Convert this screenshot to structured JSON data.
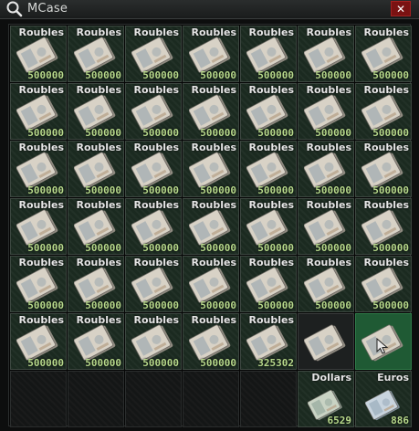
{
  "window": {
    "title": "MCase",
    "close_label": "✕"
  },
  "icons": {
    "title": "search-icon",
    "close": "close-icon",
    "cursor": "cursor-icon"
  },
  "colors": {
    "cell_filled": "#1b2a20",
    "selected": "#1f5a34",
    "close": "#7a1212",
    "count": "#b7d98b"
  },
  "grid": {
    "rows": [
      [
        {
          "name": "Roubles",
          "count": "500000"
        },
        {
          "name": "Roubles",
          "count": "500000"
        },
        {
          "name": "Roubles",
          "count": "500000"
        },
        {
          "name": "Roubles",
          "count": "500000"
        },
        {
          "name": "Roubles",
          "count": "500000"
        },
        {
          "name": "Roubles",
          "count": "500000"
        },
        {
          "name": "Roubles",
          "count": "500000"
        }
      ],
      [
        {
          "name": "Roubles",
          "count": "500000"
        },
        {
          "name": "Roubles",
          "count": "500000"
        },
        {
          "name": "Roubles",
          "count": "500000"
        },
        {
          "name": "Roubles",
          "count": "500000"
        },
        {
          "name": "Roubles",
          "count": "500000"
        },
        {
          "name": "Roubles",
          "count": "500000"
        },
        {
          "name": "Roubles",
          "count": "500000"
        }
      ],
      [
        {
          "name": "Roubles",
          "count": "500000"
        },
        {
          "name": "Roubles",
          "count": "500000"
        },
        {
          "name": "Roubles",
          "count": "500000"
        },
        {
          "name": "Roubles",
          "count": "500000"
        },
        {
          "name": "Roubles",
          "count": "500000"
        },
        {
          "name": "Roubles",
          "count": "500000"
        },
        {
          "name": "Roubles",
          "count": "500000"
        }
      ],
      [
        {
          "name": "Roubles",
          "count": "500000"
        },
        {
          "name": "Roubles",
          "count": "500000"
        },
        {
          "name": "Roubles",
          "count": "500000"
        },
        {
          "name": "Roubles",
          "count": "500000"
        },
        {
          "name": "Roubles",
          "count": "500000"
        },
        {
          "name": "Roubles",
          "count": "500000"
        },
        {
          "name": "Roubles",
          "count": "500000"
        }
      ],
      [
        {
          "name": "Roubles",
          "count": "500000"
        },
        {
          "name": "Roubles",
          "count": "500000"
        },
        {
          "name": "Roubles",
          "count": "500000"
        },
        {
          "name": "Roubles",
          "count": "500000"
        },
        {
          "name": "Roubles",
          "count": "500000"
        },
        {
          "name": "Roubles",
          "count": "500000"
        },
        {
          "name": "Roubles",
          "count": "500000"
        }
      ],
      [
        {
          "name": "Roubles",
          "count": "500000"
        },
        {
          "name": "Roubles",
          "count": "500000"
        },
        {
          "name": "Roubles",
          "count": "500000"
        },
        {
          "name": "Roubles",
          "count": "500000"
        },
        {
          "name": "Roubles",
          "count": "325302"
        },
        {
          "name": "",
          "count": "",
          "state": "plain"
        },
        {
          "name": "",
          "count": "",
          "state": "selected"
        }
      ],
      [
        {
          "empty": true
        },
        {
          "empty": true
        },
        {
          "empty": true
        },
        {
          "empty": true
        },
        {
          "empty": true
        },
        {
          "name": "Dollars",
          "count": "6529",
          "currency": "usd"
        },
        {
          "name": "Euros",
          "count": "886",
          "currency": "eur"
        }
      ]
    ]
  }
}
